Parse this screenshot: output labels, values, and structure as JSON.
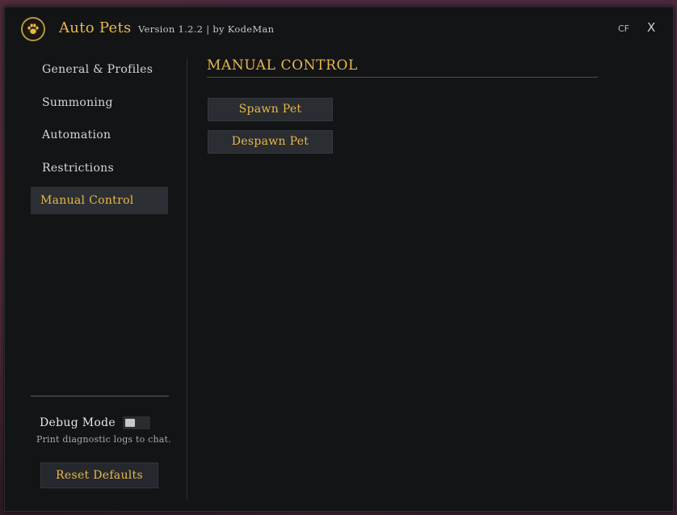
{
  "header": {
    "app_title": "Auto Pets",
    "version": "Version 1.2.2  |  by KodeMan",
    "cf_label": "CF",
    "close_label": "X",
    "logo_icon": "paw-icon"
  },
  "sidebar": {
    "items": [
      {
        "label": "General & Profiles",
        "active": false
      },
      {
        "label": "Summoning",
        "active": false
      },
      {
        "label": "Automation",
        "active": false
      },
      {
        "label": "Restrictions",
        "active": false
      },
      {
        "label": "Manual Control",
        "active": true
      }
    ],
    "debug": {
      "label": "Debug Mode",
      "description": "Print diagnostic logs to chat.",
      "enabled": false
    },
    "reset_label": "Reset Defaults"
  },
  "main": {
    "title": "MANUAL CONTROL",
    "buttons": [
      {
        "label": "Spawn Pet"
      },
      {
        "label": "Despawn Pet"
      }
    ]
  },
  "colors": {
    "accent": "#e8b84a",
    "panel_bg": "#121416",
    "active_item_bg": "#2c2f33"
  }
}
